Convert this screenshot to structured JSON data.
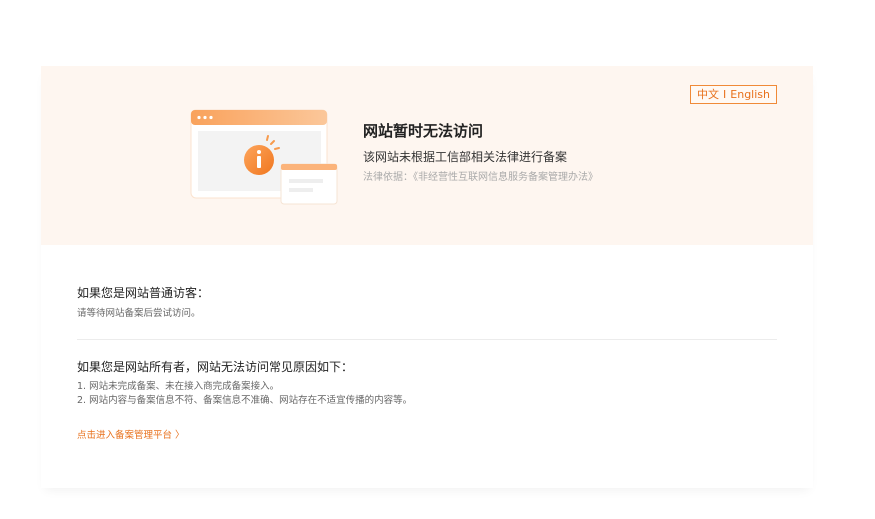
{
  "lang_switch": {
    "chinese": "中文",
    "separator": "I",
    "english": "English"
  },
  "banner": {
    "title": "网站暂时无法访问",
    "subtitle": "该网站未根据工信部相关法律进行备案",
    "legal_basis": "法律依据：《非经营性互联网信息服务备案管理办法》"
  },
  "visitor_section": {
    "title": "如果您是网站普通访客：",
    "text": "请等待网站备案后尝试访问。"
  },
  "owner_section": {
    "title": "如果您是网站所有者，网站无法访问常见原因如下：",
    "reasons": [
      "1. 网站未完成备案、未在接入商完成备案接入。",
      "2. 网站内容与备案信息不符、备案信息不准确、网站存在不适宜传播的内容等。"
    ]
  },
  "platform_link": "点击进入备案管理平台 〉",
  "colors": {
    "accent": "#e8711c",
    "banner_bg": "#fef6f0"
  },
  "icons": [
    "browser-window-illustration",
    "info-icon"
  ]
}
